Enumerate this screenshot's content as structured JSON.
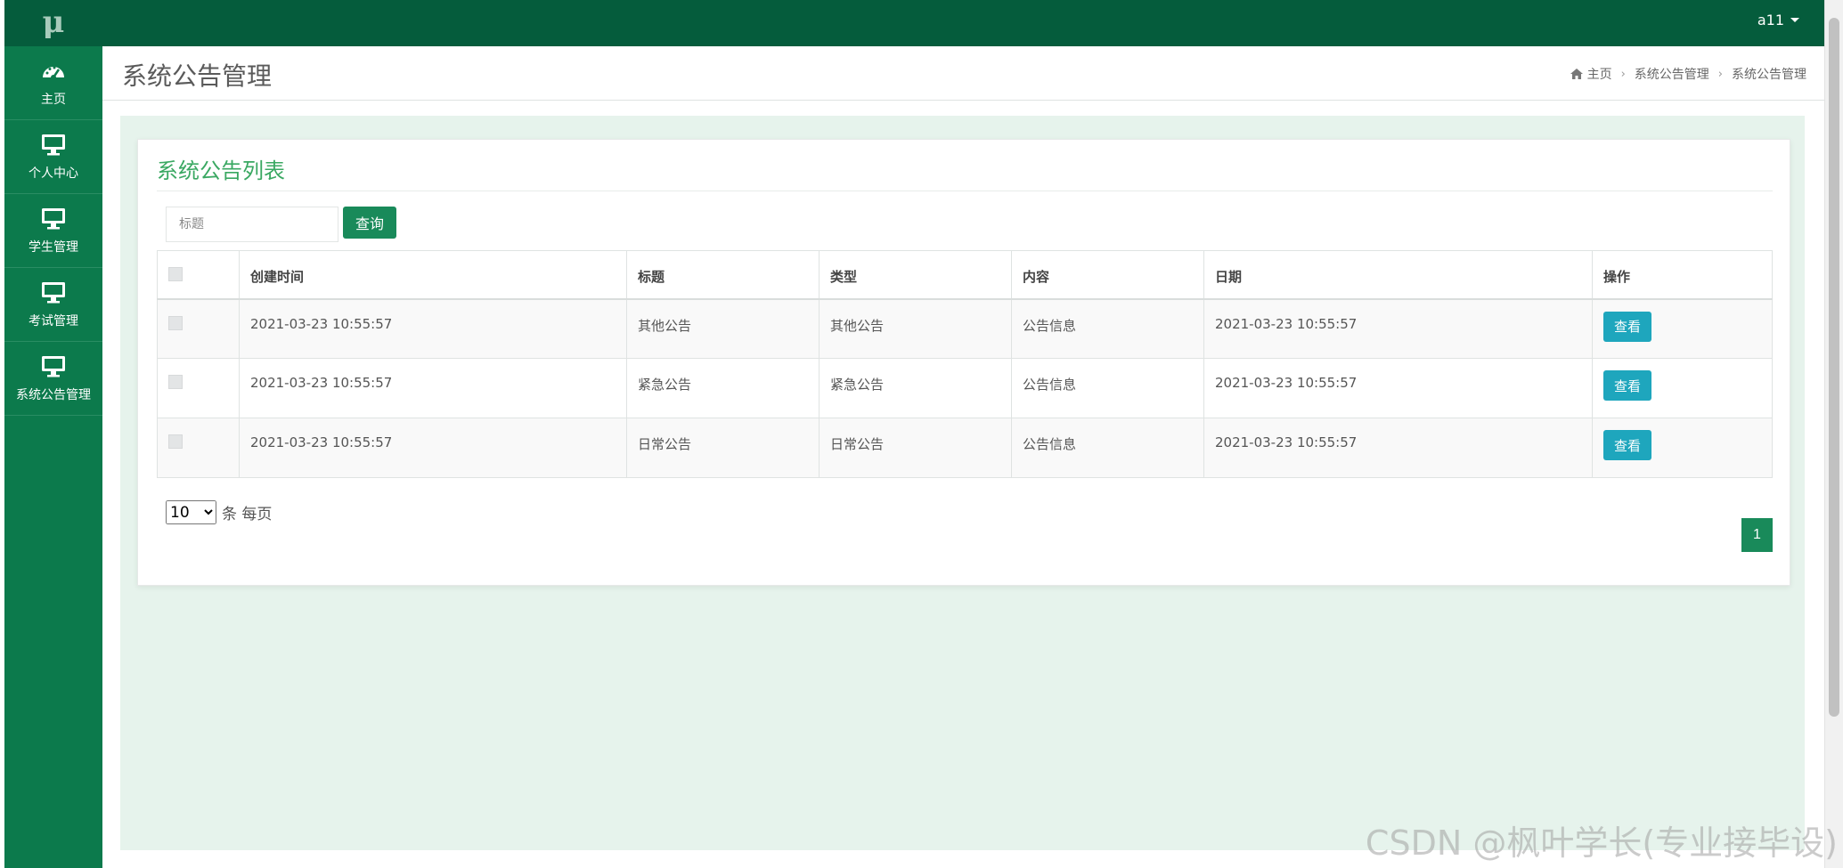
{
  "sidebar": {
    "logo": "μ",
    "items": [
      {
        "label": "主页",
        "icon": "dashboard-icon"
      },
      {
        "label": "个人中心",
        "icon": "monitor-icon"
      },
      {
        "label": "学生管理",
        "icon": "monitor-icon"
      },
      {
        "label": "考试管理",
        "icon": "monitor-icon"
      },
      {
        "label": "系统公告管理",
        "icon": "monitor-icon"
      }
    ]
  },
  "topbar": {
    "username": "a11"
  },
  "header": {
    "title": "系统公告管理",
    "breadcrumb": [
      "主页",
      "系统公告管理",
      "系统公告管理"
    ]
  },
  "panel": {
    "title": "系统公告列表",
    "search_placeholder": "标题",
    "search_button": "查询"
  },
  "table": {
    "columns": [
      "创建时间",
      "标题",
      "类型",
      "内容",
      "日期",
      "操作"
    ],
    "rows": [
      {
        "created": "2021-03-23 10:55:57",
        "title": "其他公告",
        "type": "其他公告",
        "content": "公告信息",
        "date": "2021-03-23 10:55:57",
        "action": "查看"
      },
      {
        "created": "2021-03-23 10:55:57",
        "title": "紧急公告",
        "type": "紧急公告",
        "content": "公告信息",
        "date": "2021-03-23 10:55:57",
        "action": "查看"
      },
      {
        "created": "2021-03-23 10:55:57",
        "title": "日常公告",
        "type": "日常公告",
        "content": "公告信息",
        "date": "2021-03-23 10:55:57",
        "action": "查看"
      }
    ]
  },
  "pagination": {
    "page_size_value": "10",
    "page_size_suffix": "条 每页",
    "current_page": "1"
  },
  "watermark": "CSDN @枫叶学长(专业接毕设)",
  "colors": {
    "sidebar": "#0c7a4c",
    "topbar": "#055c3c",
    "accent_green": "#198a5a",
    "title_green": "#3aa862",
    "view_button": "#1ea6bd",
    "content_bg": "#e6f3ec"
  }
}
